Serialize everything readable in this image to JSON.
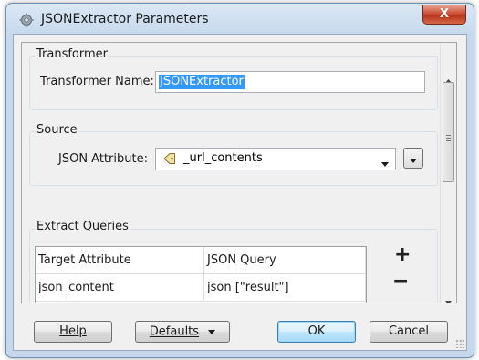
{
  "window": {
    "title": "JSONExtractor Parameters",
    "close_glyph": "X"
  },
  "transformer": {
    "group_title": "Transformer",
    "name_label": "Transformer Name:",
    "name_value": "JSONExtractor"
  },
  "source": {
    "group_title": "Source",
    "attribute_label": "JSON Attribute:",
    "attribute_value": "_url_contents",
    "attribute_icon": "attribute-tag-icon"
  },
  "queries": {
    "group_title": "Extract Queries",
    "columns": [
      "Target Attribute",
      "JSON Query"
    ],
    "rows": [
      {
        "target": "json_content",
        "query": "json [\"result\"]"
      }
    ],
    "add_glyph": "+",
    "remove_glyph": "−"
  },
  "buttons": {
    "help": "Help",
    "defaults": "Defaults",
    "ok": "OK",
    "cancel": "Cancel"
  },
  "colors": {
    "selection": "#3399ff",
    "default_button": "#a7d9f5",
    "close_button": "#c9452c"
  }
}
